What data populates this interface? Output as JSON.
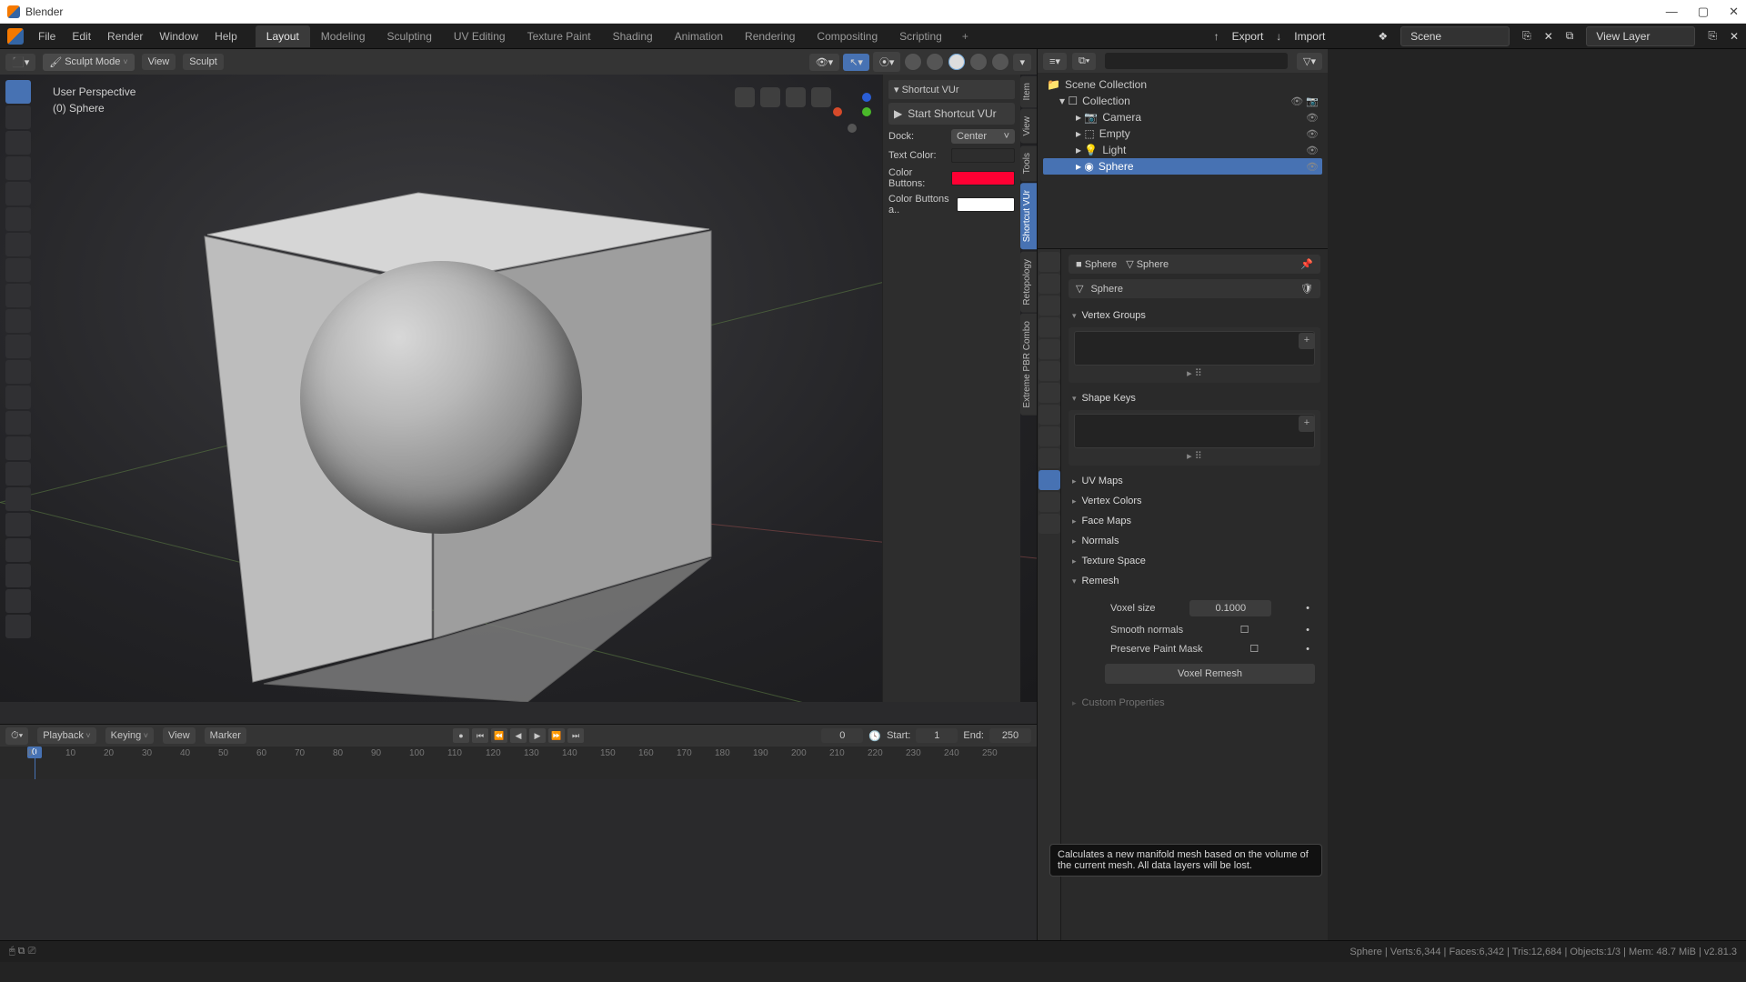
{
  "title": "Blender",
  "menu": {
    "file": "File",
    "edit": "Edit",
    "render": "Render",
    "window": "Window",
    "help": "Help"
  },
  "workspaces": [
    "Layout",
    "Modeling",
    "Sculpting",
    "UV Editing",
    "Texture Paint",
    "Shading",
    "Animation",
    "Rendering",
    "Compositing",
    "Scripting"
  ],
  "ws_active": 0,
  "export": "Export",
  "import": "Import",
  "scene_label": "Scene",
  "viewlayer_label": "View Layer",
  "viewport": {
    "mode": "Sculpt Mode",
    "view": "View",
    "sculpt": "Sculpt",
    "persp": "User Perspective",
    "obj": "(0) Sphere"
  },
  "shortcut_panel": {
    "title": "Shortcut VUr",
    "start": "Start Shortcut VUr",
    "dock_l": "Dock:",
    "dock_v": "Center",
    "textcolor_l": "Text Color:",
    "textcolor": "#ffffff",
    "btncolor_l": "Color Buttons:",
    "btncolor": "#ff0033",
    "btncolor2_l": "Color Buttons a..",
    "btncolor2": "#ffffff"
  },
  "side_tabs": [
    "Item",
    "View",
    "Tools",
    "Shortcut VUr",
    "Retopology",
    "Extreme PBR Combo"
  ],
  "side_tab_active": 3,
  "outliner": {
    "root": "Scene Collection",
    "collection": "Collection",
    "items": [
      "Camera",
      "Empty",
      "Light",
      "Sphere"
    ],
    "selected": 3
  },
  "props": {
    "crumb_obj": "Sphere",
    "crumb_mesh": "Sphere",
    "name": "Sphere",
    "panels": {
      "vertex_groups": "Vertex Groups",
      "shape_keys": "Shape Keys",
      "uv_maps": "UV Maps",
      "vertex_colors": "Vertex Colors",
      "face_maps": "Face Maps",
      "normals": "Normals",
      "texture_space": "Texture Space",
      "remesh": "Remesh",
      "custom": "Custom Properties"
    },
    "remesh": {
      "voxel_l": "Voxel size",
      "voxel_v": "0.1000",
      "smooth_l": "Smooth normals",
      "mask_l": "Preserve Paint Mask",
      "btn": "Voxel Remesh"
    },
    "tooltip": "Calculates a new manifold mesh based on the volume of the current mesh. All data layers will be lost."
  },
  "timeline": {
    "menus": {
      "playback": "Playback",
      "keying": "Keying",
      "view": "View",
      "marker": "Marker"
    },
    "frame": "0",
    "start_l": "Start:",
    "start": "1",
    "end_l": "End:",
    "end": "250",
    "ticks": [
      0,
      10,
      20,
      30,
      40,
      50,
      60,
      70,
      80,
      90,
      100,
      110,
      120,
      130,
      140,
      150,
      160,
      170,
      180,
      190,
      200,
      210,
      220,
      230,
      240,
      250
    ]
  },
  "status": "Sphere | Verts:6,344 | Faces:6,342 | Tris:12,684 | Objects:1/3 | Mem: 48.7 MiB | v2.81.3"
}
